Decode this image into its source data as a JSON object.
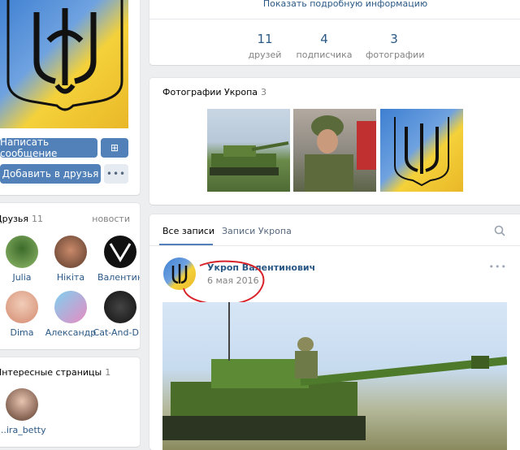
{
  "profile": {
    "top_info_link": "Показать подробную информацию",
    "stats": [
      {
        "value": "11",
        "label": "друзей"
      },
      {
        "value": "4",
        "label": "подписчика"
      },
      {
        "value": "3",
        "label": "фотографии"
      }
    ],
    "photos_section": {
      "title": "Фотографии Укропа",
      "count": "3"
    }
  },
  "left": {
    "send_message": "Написать сообщение",
    "add_friend": "Добавить в друзья",
    "friends_title": "Друзья",
    "friends_count": "11",
    "friends_new": "новости",
    "friends": [
      {
        "name": "Julia"
      },
      {
        "name": "Нікіта"
      },
      {
        "name": "Валентин"
      },
      {
        "name": "Dima"
      },
      {
        "name": "Александр"
      },
      {
        "name": "Cat-And-D..."
      }
    ],
    "pages_title": "Интересные страницы",
    "pages_count": "1",
    "pages_item": "...ira_betty"
  },
  "wall": {
    "tabs": [
      "Все записи",
      "Записи Укропа"
    ],
    "post": {
      "author": "Укроп Валентинович",
      "date": "6 мая 2016"
    }
  },
  "colors": {
    "accent": "#5181b8",
    "link": "#2a5885",
    "annotation": "#d9232a"
  }
}
